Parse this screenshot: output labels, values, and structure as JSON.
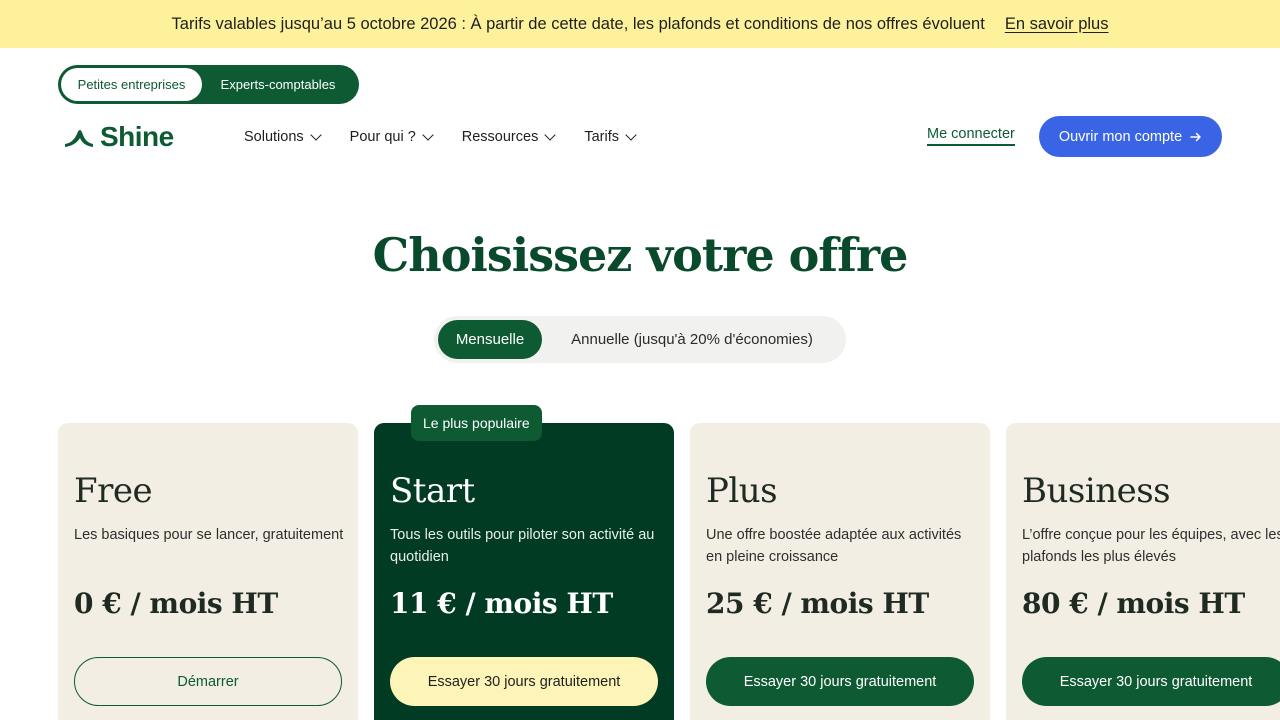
{
  "banner": {
    "text": "Tarifs valables jusqu’au 5 octobre 2026 : À partir de cette date, les plafonds et conditions de nos offres évoluent",
    "link": "En savoir plus"
  },
  "audience_switch": {
    "options": [
      "Petites entreprises",
      "Experts-comptables"
    ],
    "selected": "Petites entreprises"
  },
  "brand": {
    "name": "Shine",
    "color": "#0d5a33"
  },
  "nav": {
    "items": [
      {
        "label": "Solutions"
      },
      {
        "label": "Pour qui ?"
      },
      {
        "label": "Ressources"
      },
      {
        "label": "Tarifs"
      }
    ],
    "login": "Me connecter",
    "cta": "Ouvrir mon compte",
    "cta_color": "#3a64e6"
  },
  "hero": {
    "title": "Choisissez votre offre"
  },
  "billing_toggle": {
    "options": [
      "Mensuelle",
      "Annuelle (jusqu'à 20% d'économies)"
    ],
    "selected": "Mensuelle"
  },
  "plans": [
    {
      "name": "Free",
      "description": "Les basiques pour se lancer, gratuitement",
      "price": "0 € / mois HT",
      "cta": "Démarrer"
    },
    {
      "name": "Start",
      "badge": "Le plus populaire",
      "description": "Tous les outils pour piloter son activité au quotidien",
      "price": "11 € / mois HT",
      "cta": "Essayer 30 jours gratuitement"
    },
    {
      "name": "Plus",
      "description": "Une offre boostée adaptée aux activités en pleine croissance",
      "price": "25 € / mois HT",
      "cta": "Essayer 30 jours gratuitement"
    },
    {
      "name": "Business",
      "description": "L’offre conçue pour les équipes, avec les plafonds les plus élevés",
      "price": "80 € / mois HT",
      "cta": "Essayer 30 jours gratuitement"
    }
  ]
}
